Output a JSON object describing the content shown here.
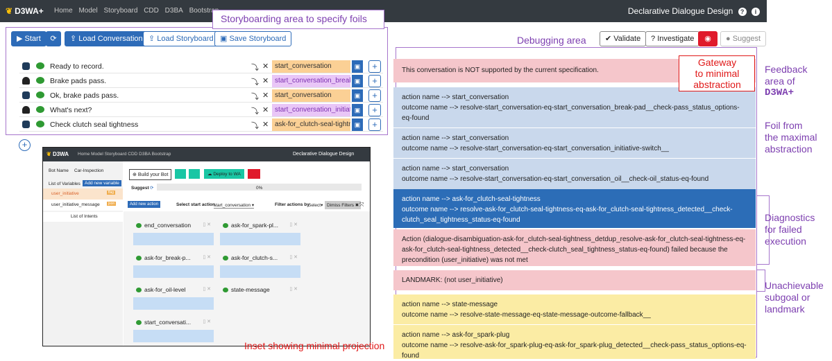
{
  "navbar": {
    "brand": "D3WA+",
    "links": [
      "Home",
      "Model",
      "Storyboard",
      "CDD",
      "D3BA",
      "Bootstrap"
    ],
    "right_title": "Declarative Dialogue Design",
    "help_icon": "question-circle-icon",
    "info_icon": "info-circle-icon"
  },
  "toolbar": {
    "start": "Start",
    "load_conversation": "Load Conversation",
    "load_storyboard": "Load Storyboard",
    "save_storyboard": "Save Storyboard"
  },
  "conversation": [
    {
      "speaker": "bot",
      "text": "Ready to record.",
      "action": "start_conversation",
      "action_color": "orange"
    },
    {
      "speaker": "user",
      "text": "Brake pads pass.",
      "action": "start_conversation_break-p",
      "action_color": "pink"
    },
    {
      "speaker": "bot",
      "text": "Ok, brake pads pass.",
      "action": "start_conversation",
      "action_color": "orange"
    },
    {
      "speaker": "user",
      "text": "What's next?",
      "action": "start_conversation_initiative",
      "action_color": "pink"
    },
    {
      "speaker": "bot",
      "text": "Check clutch seal tightness",
      "action": "ask-for_clutch-seal-tightne",
      "action_color": "orange"
    }
  ],
  "right_toolbar": {
    "validate": "Validate",
    "investigate": "Investigate",
    "suggest": "Suggest"
  },
  "annotations": {
    "storyboarding": "Storyboarding area to specify foils",
    "debugging": "Debugging area",
    "gateway": "Gateway\nto minimal\nabstraction",
    "feedback_1": "Feedback",
    "feedback_2": "area of",
    "feedback_3": "D3WA+",
    "foil": "Foil from\nthe maximal\nabstraction",
    "diagnostics": "Diagnostics\nfor failed\nexecution",
    "unachievable": "Unachievable\nsubgoal or\nlandmark",
    "inset": "Inset showing minimal projection"
  },
  "feedback": {
    "error": "This conversation is NOT supported by the current specification.",
    "foils": [
      {
        "action": "action name --> start_conversation",
        "outcome": "outcome name --> resolve-start_conversation-eq-start_conversation_break-pad__check-pass_status_options-eq-found"
      },
      {
        "action": "action name --> start_conversation",
        "outcome": "outcome name --> resolve-start_conversation-eq-start_conversation_initiative-switch__"
      },
      {
        "action": "action name --> start_conversation",
        "outcome": "outcome name --> resolve-start_conversation-eq-start_conversation_oil__check-oil_status-eq-found"
      }
    ],
    "highlighted": {
      "action": "action name --> ask-for_clutch-seal-tightness",
      "outcome": "outcome name --> resolve-ask-for_clutch-seal-tightness-eq-ask-for_clutch-seal-tightness_detected__check-clutch_seal_tightness_status-eq-found"
    },
    "failure": "Action (dialogue-disambiguation-ask-for_clutch-seal-tightness_detdup_resolve-ask-for_clutch-seal-tightness-eq-ask-for_clutch-seal-tightness_detected__check-clutch_seal_tightness_status-eq-found) failed because the precondition (user_initiative) was not met",
    "landmark": "LANDMARK: (not user_initiative)",
    "remaining": [
      {
        "action": "action name --> state-message",
        "outcome": "outcome name --> resolve-state-message-eq-state-message-outcome-fallback__"
      },
      {
        "action": "action name --> ask-for_spark-plug",
        "outcome": "outcome name --> resolve-ask-for_spark-plug-eq-ask-for_spark-plug_detected__check-pass_status_options-eq-found"
      }
    ]
  },
  "inset": {
    "brand": "D3WA",
    "links": "Home  Model  Storyboard  CDD  D3BA  Bootstrap",
    "right_title": "Declarative Dialogue Design",
    "bot_name_label": "Bot Name",
    "bot_name": "Car-Inspection",
    "list_variables": "List of Variables",
    "add_variable": "Add new variable",
    "vars": [
      {
        "name": "user_initiative",
        "type": "flag"
      },
      {
        "name": "user_initiative_message",
        "type": "json"
      }
    ],
    "list_intents": "List of Intents",
    "build_bot": "Build your Bot",
    "deploy": "Deploy to WA",
    "suggest": "Suggest",
    "percent": "0%",
    "add_action": "Add new action",
    "select_start": "Select start action",
    "start_value": "start_conversation",
    "filter": "Filter actions by",
    "select": "Select",
    "dismiss": "Dimiss Filters",
    "cards": [
      "end_conversation",
      "ask-for_spark-pl...",
      "ask-for_break-p...",
      "ask-for_clutch-s...",
      "ask-for_oil-level",
      "state-message",
      "start_conversati..."
    ]
  },
  "colors": {
    "primary": "#2d6bb8",
    "annotation_purple": "#7d3fb0",
    "annotation_red": "#e01818",
    "error_band": "#f5c6cb",
    "foil_band": "#c9d8ec",
    "highlight_band": "#2c6db7",
    "remaining_band": "#fbeca4"
  }
}
